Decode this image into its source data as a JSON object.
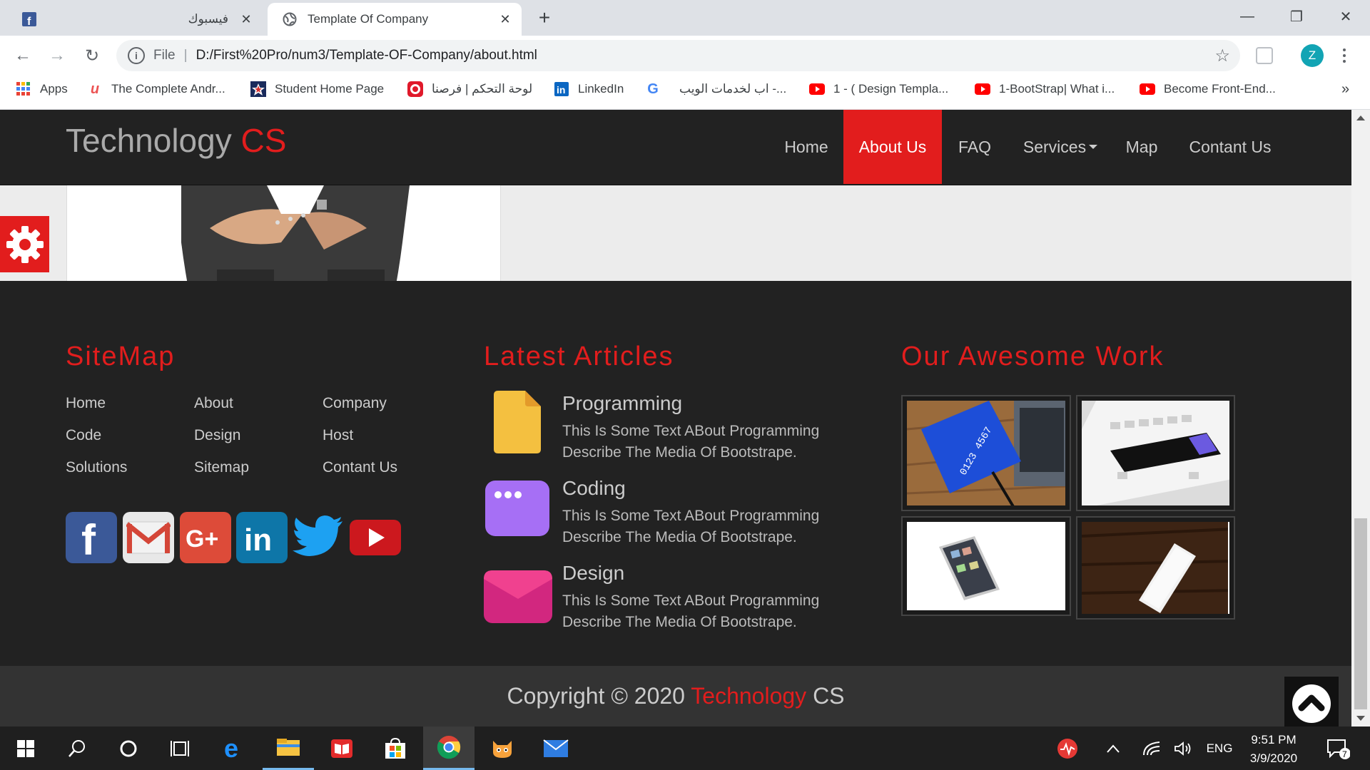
{
  "browser": {
    "tabs": [
      {
        "title": "فيسبوك",
        "favicon": "facebook-icon",
        "active": false
      },
      {
        "title": "Template Of Company",
        "favicon": "globe-icon",
        "active": true
      }
    ],
    "address": {
      "scheme": "File",
      "url": "D:/First%20Pro/num3/Template-OF-Company/about.html"
    },
    "profile_initial": "Z",
    "bookmarks": [
      {
        "label": "Apps",
        "icon": "apps-grid-icon"
      },
      {
        "label": "The Complete Andr...",
        "icon": "udemy-icon"
      },
      {
        "label": "Student Home Page",
        "icon": "star-badge-icon"
      },
      {
        "label": "لوحة التحكم | فرصنا",
        "icon": "forsa-icon"
      },
      {
        "label": "LinkedIn",
        "icon": "linkedin-icon"
      },
      {
        "label": "",
        "icon": "google-icon"
      },
      {
        "label": "اب لخدمات الويب -...",
        "icon": "youtube-icon"
      },
      {
        "label": "1 - ( Design Templa...",
        "icon": "youtube-icon"
      },
      {
        "label": "1-BootStrap| What i...",
        "icon": "youtube-icon"
      },
      {
        "label": "Become Front-End...",
        "icon": "youtube-icon"
      }
    ],
    "overflow": "»"
  },
  "site": {
    "brand": {
      "part1": "Technology",
      "part2": "CS"
    },
    "nav": [
      "Home",
      "About Us",
      "FAQ",
      "Services",
      "Map",
      "Contant Us"
    ],
    "active_nav": "About Us",
    "accent": "#e21d1d"
  },
  "footer": {
    "sitemap": {
      "title": "SiteMap",
      "links": [
        "Home",
        "About",
        "Company",
        "Code",
        "Design",
        "Host",
        "Solutions",
        "Sitemap",
        "Contant Us"
      ],
      "social": [
        "facebook-icon",
        "gmail-icon",
        "google-plus-icon",
        "linkedin-icon",
        "twitter-icon",
        "youtube-icon"
      ]
    },
    "articles": {
      "title": "Latest Articles",
      "items": [
        {
          "title": "Programming",
          "text": "This Is Some Text ABout Programming Describe The Media Of Bootstrape.",
          "icon": "document-icon",
          "color": "#f4c040"
        },
        {
          "title": "Coding",
          "text": "This Is Some Text ABout Programming Describe The Media Of Bootstrape.",
          "icon": "browser-window-icon",
          "color": "#a66ff5"
        },
        {
          "title": "Design",
          "text": "This Is Some Text ABout Programming Describe The Media Of Bootstrape.",
          "icon": "envelope-icon",
          "color": "#e8318d"
        }
      ]
    },
    "work": {
      "title": "Our Awesome Work"
    },
    "copyright": {
      "prefix": "Copyright © 2020",
      "brand1": "Technology",
      "brand2": "CS"
    }
  },
  "taskbar": {
    "lang": "ENG",
    "time": "9:51 PM",
    "date": "3/9/2020",
    "notifications": "7"
  }
}
